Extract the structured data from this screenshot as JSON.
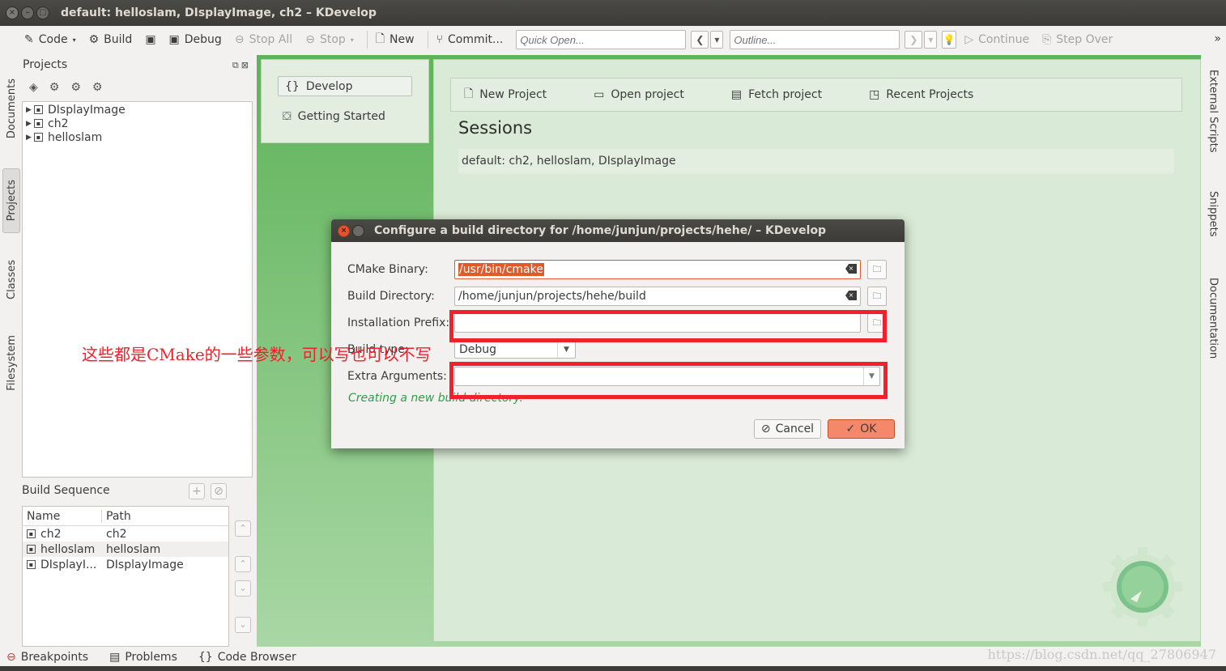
{
  "window": {
    "title": "default:  helloslam, DIsplayImage, ch2 – KDevelop"
  },
  "toolbar": {
    "code": "Code",
    "build": "Build",
    "debug": "Debug",
    "stop_all": "Stop All",
    "stop": "Stop",
    "new": "New",
    "commit": "Commit...",
    "quick_open_placeholder": "Quick Open...",
    "outline_placeholder": "Outline...",
    "continue": "Continue",
    "step_over": "Step Over",
    "overflow": "»"
  },
  "left_tabs": [
    "Documents",
    "Projects",
    "Classes",
    "Filesystem"
  ],
  "right_tabs": [
    "External Scripts",
    "Snippets",
    "Documentation"
  ],
  "projects_panel": {
    "title": "Projects",
    "items": [
      "DIsplayImage",
      "ch2",
      "helloslam"
    ]
  },
  "build_sequence": {
    "title": "Build Sequence",
    "columns": [
      "Name",
      "Path"
    ],
    "rows": [
      {
        "name": "ch2",
        "path": "ch2"
      },
      {
        "name": "helloslam",
        "path": "helloslam"
      },
      {
        "name": "DIsplayI...",
        "path": "DIsplayImage"
      }
    ]
  },
  "bottom_tabs": [
    "Breakpoints",
    "Problems",
    "Code Browser"
  ],
  "watermark": "https://blog.csdn.net/qq_27806947",
  "welcome": {
    "develop": "Develop",
    "getting_started": "Getting Started",
    "new_project": "New Project",
    "open_project": "Open project",
    "fetch_project": "Fetch project",
    "recent_projects": "Recent Projects",
    "sessions_title": "Sessions",
    "session_item": "default: ch2, helloslam, DIsplayImage"
  },
  "dialog": {
    "title": "Configure a build directory for /home/junjun/projects/hehe/ – KDevelop",
    "cmake_label": "CMake Binary:",
    "cmake_value": "/usr/bin/cmake",
    "build_dir_label": "Build Directory:",
    "build_dir_value": "/home/junjun/projects/hehe/build",
    "install_prefix_label": "Installation Prefix:",
    "install_prefix_value": "",
    "build_type_label": "Build type:",
    "build_type_value": "Debug",
    "extra_args_label": "Extra Arguments:",
    "extra_args_value": "",
    "status": "Creating a new build directory.",
    "cancel": "Cancel",
    "ok": "OK"
  },
  "annotation": {
    "text": "这些都是CMake的一些参数，可以写也可以不写",
    "color": "#f0202c"
  },
  "colors": {
    "accent": "#e05a2b",
    "green_bg": "#5fb35a",
    "annotation": "#f0202c"
  }
}
